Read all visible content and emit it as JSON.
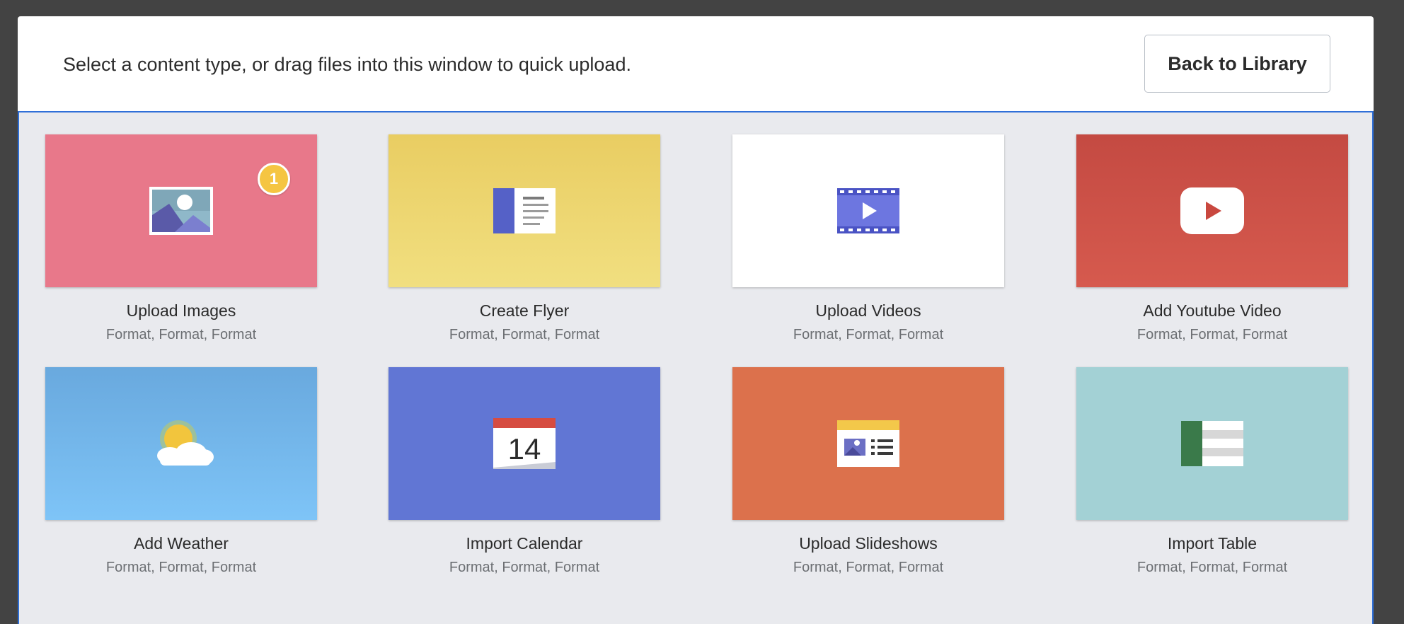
{
  "header": {
    "instructions": "Select a content type, or drag files into this window to quick upload.",
    "back_button": "Back to Library"
  },
  "colors": {
    "accent_border": "#2f6fd8",
    "badge": "#f5c542"
  },
  "cards": [
    {
      "title": "Upload Images",
      "subtitle": "Format, Format, Format",
      "icon": "image-icon",
      "color": "#e8788a",
      "badge": "1"
    },
    {
      "title": "Create Flyer",
      "subtitle": "Format, Format, Format",
      "icon": "flyer-icon",
      "color": "#eed56f"
    },
    {
      "title": "Upload Videos",
      "subtitle": "Format, Format, Format",
      "icon": "video-icon",
      "color": "#ffffff"
    },
    {
      "title": "Add Youtube Video",
      "subtitle": "Format, Format, Format",
      "icon": "youtube-icon",
      "color": "#cc5148"
    },
    {
      "title": "Add Weather",
      "subtitle": "Format, Format, Format",
      "icon": "weather-icon",
      "color": "#74b7ec"
    },
    {
      "title": "Import Calendar",
      "subtitle": "Format, Format, Format",
      "icon": "calendar-icon",
      "color": "#6176d4",
      "date": "14"
    },
    {
      "title": "Upload Slideshows",
      "subtitle": "Format, Format, Format",
      "icon": "slideshow-icon",
      "color": "#dc714c"
    },
    {
      "title": "Import Table",
      "subtitle": "Format, Format, Format",
      "icon": "table-icon",
      "color": "#a3d1d5"
    }
  ]
}
